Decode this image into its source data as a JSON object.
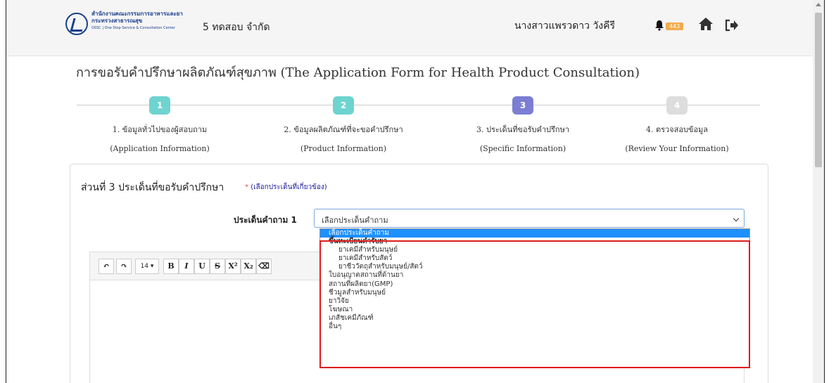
{
  "header": {
    "logo_line1": "สำนักงานคณะกรรมการอาหารและยา",
    "logo_line2": "กระทรวงสาธารณสุข",
    "logo_line3": "OSSC | One Stop Service & Consultation Center",
    "company": "5 ทดสอบ จำกัด",
    "username": "นางสาวแพรวดาว วังคีรี",
    "notification_count": "443"
  },
  "page": {
    "title": "การขอรับคำปรึกษาผลิตภัณฑ์สุขภาพ (The Application Form for Health Product Consultation)"
  },
  "steps": [
    {
      "num": "1",
      "label": "1. ข้อมูลทั่วไปของผู้สอบถาม",
      "sublabel": "(Application Information)",
      "color": "#6fd3cf"
    },
    {
      "num": "2",
      "label": "2. ข้อมูลผลิตภัณฑ์ที่จะขอคำปรึกษา",
      "sublabel": "(Product Information)",
      "color": "#6fd3cf"
    },
    {
      "num": "3",
      "label": "3. ประเด็นที่ขอรับคำปรึกษา",
      "sublabel": "(Specific Information)",
      "color": "#7b7ed3"
    },
    {
      "num": "4",
      "label": "4. ตรวจสอบข้อมูล",
      "sublabel": "(Review Your Information)",
      "color": "#dddddd"
    }
  ],
  "section": {
    "title": "ส่วนที่ 3 ประเด็นที่ขอรับคำปรึกษา",
    "hint_star": "*",
    "hint": "(เลือกประเด็นที่เกี่ยวข้อง)",
    "question_label": "ประเด็นคำถาม 1",
    "select_value": "เลือกประเด็นคำถาม"
  },
  "editor": {
    "font_size": "14 ▾"
  },
  "dropdown": {
    "selected": "เลือกประเด็นคำถาม",
    "group": "ขึ้นทะเบียนตำรับยา",
    "sub_options": [
      "ยาเคมีสำหรับมนุษย์",
      "ยาเคมีสำหรับสัตว์",
      "ยาชีววัตถุสำหรับมนุษย์/สัตว์"
    ],
    "options": [
      "ใบอนุญาตสถานที่ด้านยา",
      "สถานที่ผลิตยา(GMP)",
      "ชีวมูลสำหรับมนุษย์",
      "ยาวิจัย",
      "โฆษณา",
      "เภสัชเคมีภัณฑ์",
      "อื่นๆ"
    ]
  }
}
